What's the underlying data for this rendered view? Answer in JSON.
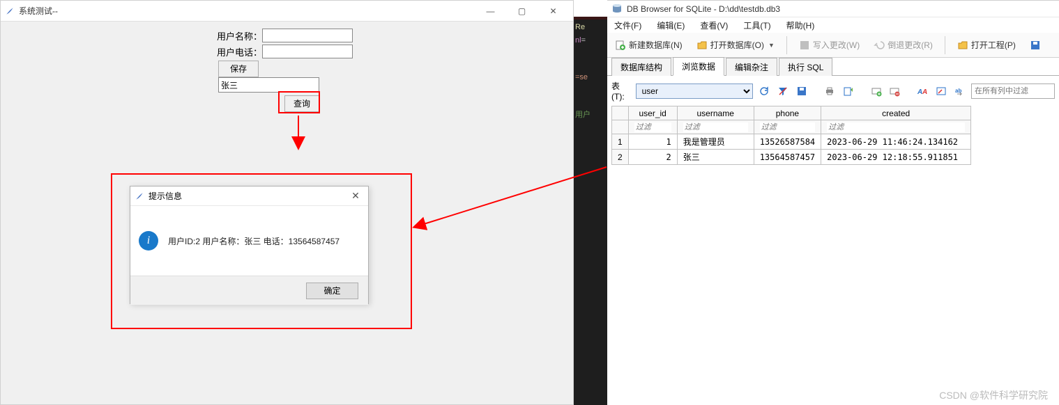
{
  "tkwin": {
    "title": "系统测试--",
    "labels": {
      "username": "用户名称：",
      "phone": "用户电话："
    },
    "buttons": {
      "save": "保存",
      "query": "查询"
    },
    "search_value": "张三"
  },
  "msgbox": {
    "title": "提示信息",
    "text": "用户ID:2 用户名称：张三 电话：13564587457",
    "ok": "确定"
  },
  "codefrags": {
    "re": "Re",
    "nl": "nl",
    "eq": "=",
    "sel": "=se",
    "zh": "用户"
  },
  "dbwin": {
    "title": "DB Browser for SQLite - D:\\dd\\testdb.db3",
    "menus": [
      "文件(F)",
      "编辑(E)",
      "查看(V)",
      "工具(T)",
      "帮助(H)"
    ],
    "toolbar": {
      "newdb": "新建数据库(N)",
      "opendb": "打开数据库(O)",
      "write": "写入更改(W)",
      "revert": "倒退更改(R)",
      "openproj": "打开工程(P)"
    },
    "tabs": [
      "数据库结构",
      "浏览数据",
      "编辑杂注",
      "执行 SQL"
    ],
    "active_tab": 1,
    "table_label": "表(T):",
    "table_selected": "user",
    "filter_placeholder": "在所有列中过滤",
    "columns": [
      "user_id",
      "username",
      "phone",
      "created"
    ],
    "filter_text": "过滤",
    "rows": [
      {
        "n": "1",
        "user_id": "1",
        "username": "我是管理员",
        "phone": "13526587584",
        "created": "2023-06-29 11:46:24.134162"
      },
      {
        "n": "2",
        "user_id": "2",
        "username": "张三",
        "phone": "13564587457",
        "created": "2023-06-29 12:18:55.911851"
      }
    ]
  },
  "watermark": "CSDN @软件科学研究院"
}
